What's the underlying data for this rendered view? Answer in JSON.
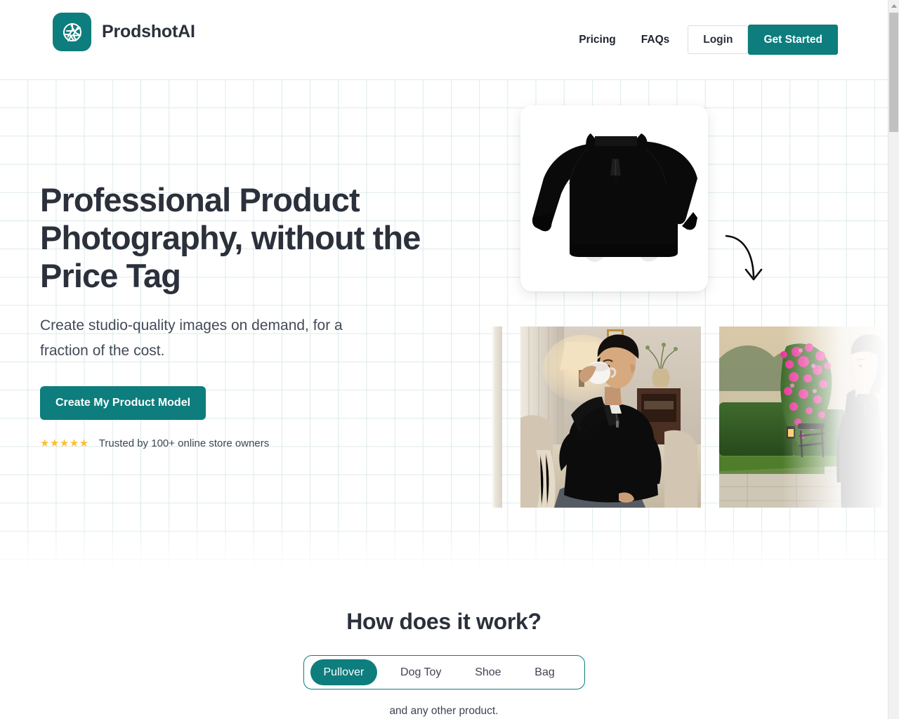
{
  "header": {
    "brand_name": "ProdshotAI",
    "logo_icon": "aperture-icon",
    "nav": [
      {
        "label": "Pricing"
      },
      {
        "label": "FAQs"
      }
    ],
    "login_label": "Login",
    "get_started_label": "Get Started"
  },
  "hero": {
    "title": "Professional Product Photography, without the Price Tag",
    "subtitle": "Create studio-quality images on demand, for a fraction of the cost.",
    "cta_label": "Create My Product Model",
    "stars": "★★★★★",
    "trust_text": "Trusted by 100+ online store owners"
  },
  "showcase": {
    "product_alt": "black quarter-zip pullover product photo",
    "arrow_icon": "curved-down-arrow-icon",
    "shots": [
      {
        "alt": "lifestyle photo partially visible"
      },
      {
        "alt": "man in black pullover drinking coffee in living room"
      },
      {
        "alt": "woman in black pullover in rose garden at sunset"
      }
    ]
  },
  "how": {
    "title": "How does it work?",
    "tabs": [
      {
        "label": "Pullover",
        "active": true
      },
      {
        "label": "Dog Toy",
        "active": false
      },
      {
        "label": "Shoe",
        "active": false
      },
      {
        "label": "Bag",
        "active": false
      }
    ],
    "note": "and any other product."
  },
  "colors": {
    "brand_teal": "#0d7d7d",
    "text_dark": "#2b303b",
    "star_gold": "#fbc02d",
    "grid_line": "#dcebe9"
  },
  "scrollbar": {
    "up_arrow_icon": "triangle-up-icon"
  }
}
